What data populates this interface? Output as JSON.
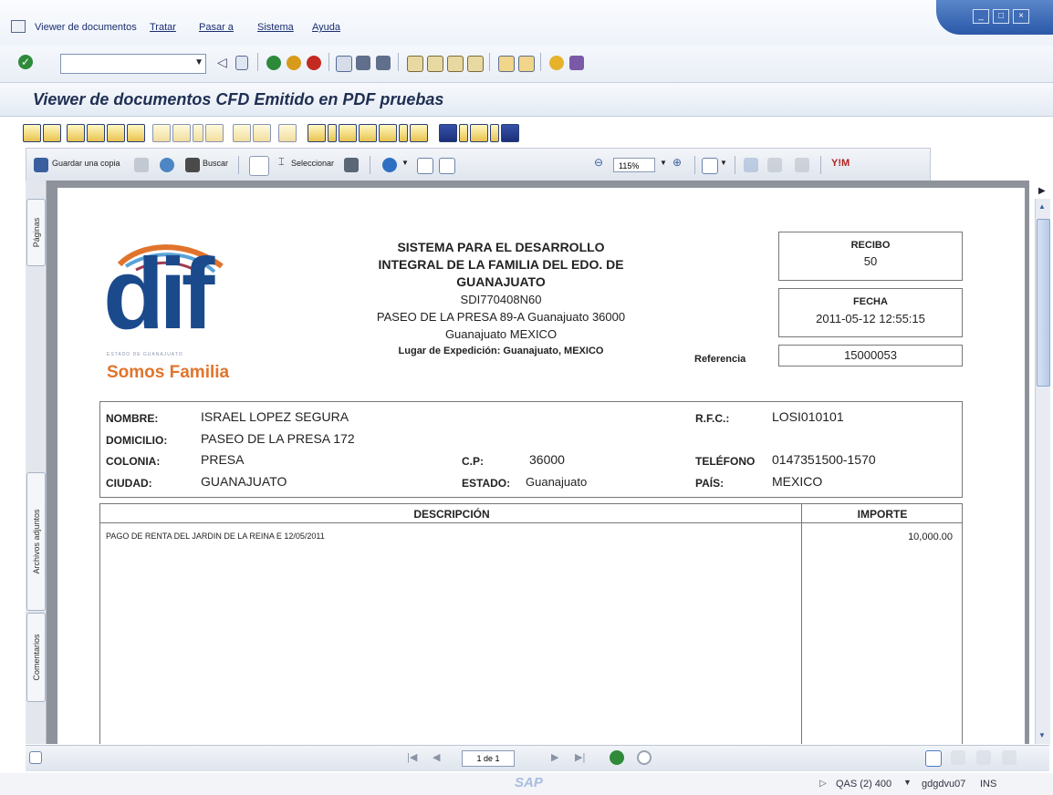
{
  "menu": {
    "items": [
      "Viewer de documentos",
      "Tratar",
      "Pasar a",
      "Sistema",
      "Ayuda"
    ]
  },
  "window_title": "Viewer de documentos CFD Emitido en PDF pruebas",
  "pdf_toolbar": {
    "save_copy": "Guardar una copia",
    "search": "Buscar",
    "select": "Seleccionar",
    "zoom": "115%"
  },
  "side_tabs": {
    "pages": "Páginas",
    "attachments": "Archivos adjuntos",
    "comments": "Comentarios"
  },
  "document": {
    "logo_text": "dif",
    "logo_tagline": "Somos Familia",
    "logo_small": "ESTADO DE GUANAJUATO",
    "issuer": {
      "line1": "SISTEMA PARA EL DESARROLLO",
      "line2": "INTEGRAL DE LA FAMILIA DEL EDO. DE",
      "line3": "GUANAJUATO",
      "rfc": "SDI770408N60",
      "address": "PASEO DE LA PRESA 89-A Guanajuato 36000",
      "city": "Guanajuato MEXICO",
      "place": "Lugar de Expedición: Guanajuato, MEXICO"
    },
    "recibo_label": "RECIBO",
    "recibo_value": "50",
    "fecha_label": "FECHA",
    "fecha_value": "2011-05-12 12:55:15",
    "referencia_label": "Referencia",
    "referencia_value": "15000053",
    "client": {
      "nombre_label": "NOMBRE:",
      "nombre": "ISRAEL LOPEZ SEGURA",
      "rfc_label": "R.F.C.:",
      "rfc": "LOSI010101",
      "domicilio_label": "DOMICILIO:",
      "domicilio": "PASEO DE LA PRESA 172",
      "colonia_label": "COLONIA:",
      "colonia": "PRESA",
      "cp_label": "C.P:",
      "cp": "36000",
      "telefono_label": "TELÉFONO",
      "telefono": "0147351500-1570",
      "ciudad_label": "CIUDAD:",
      "ciudad": "GUANAJUATO",
      "estado_label": "ESTADO:",
      "estado": "Guanajuato",
      "pais_label": "PAÍS:",
      "pais": "MEXICO"
    },
    "table": {
      "col_desc": "DESCRIPCIÓN",
      "col_importe": "IMPORTE",
      "rows": [
        {
          "descripcion": "PAGO DE RENTA DEL JARDIN DE LA REINA E 12/05/2011",
          "importe": "10,000.00"
        }
      ]
    }
  },
  "nav": {
    "page_indicator": "1 de 1"
  },
  "status": {
    "brand": "SAP",
    "system": "QAS (2) 400",
    "user": "gdgdvu07",
    "mode": "INS"
  },
  "colors": {
    "title_text": "#1f2f52",
    "window_controls": "#2a58a8",
    "logo_blue": "#1b4a8c",
    "logo_orange": "#e0742c"
  }
}
